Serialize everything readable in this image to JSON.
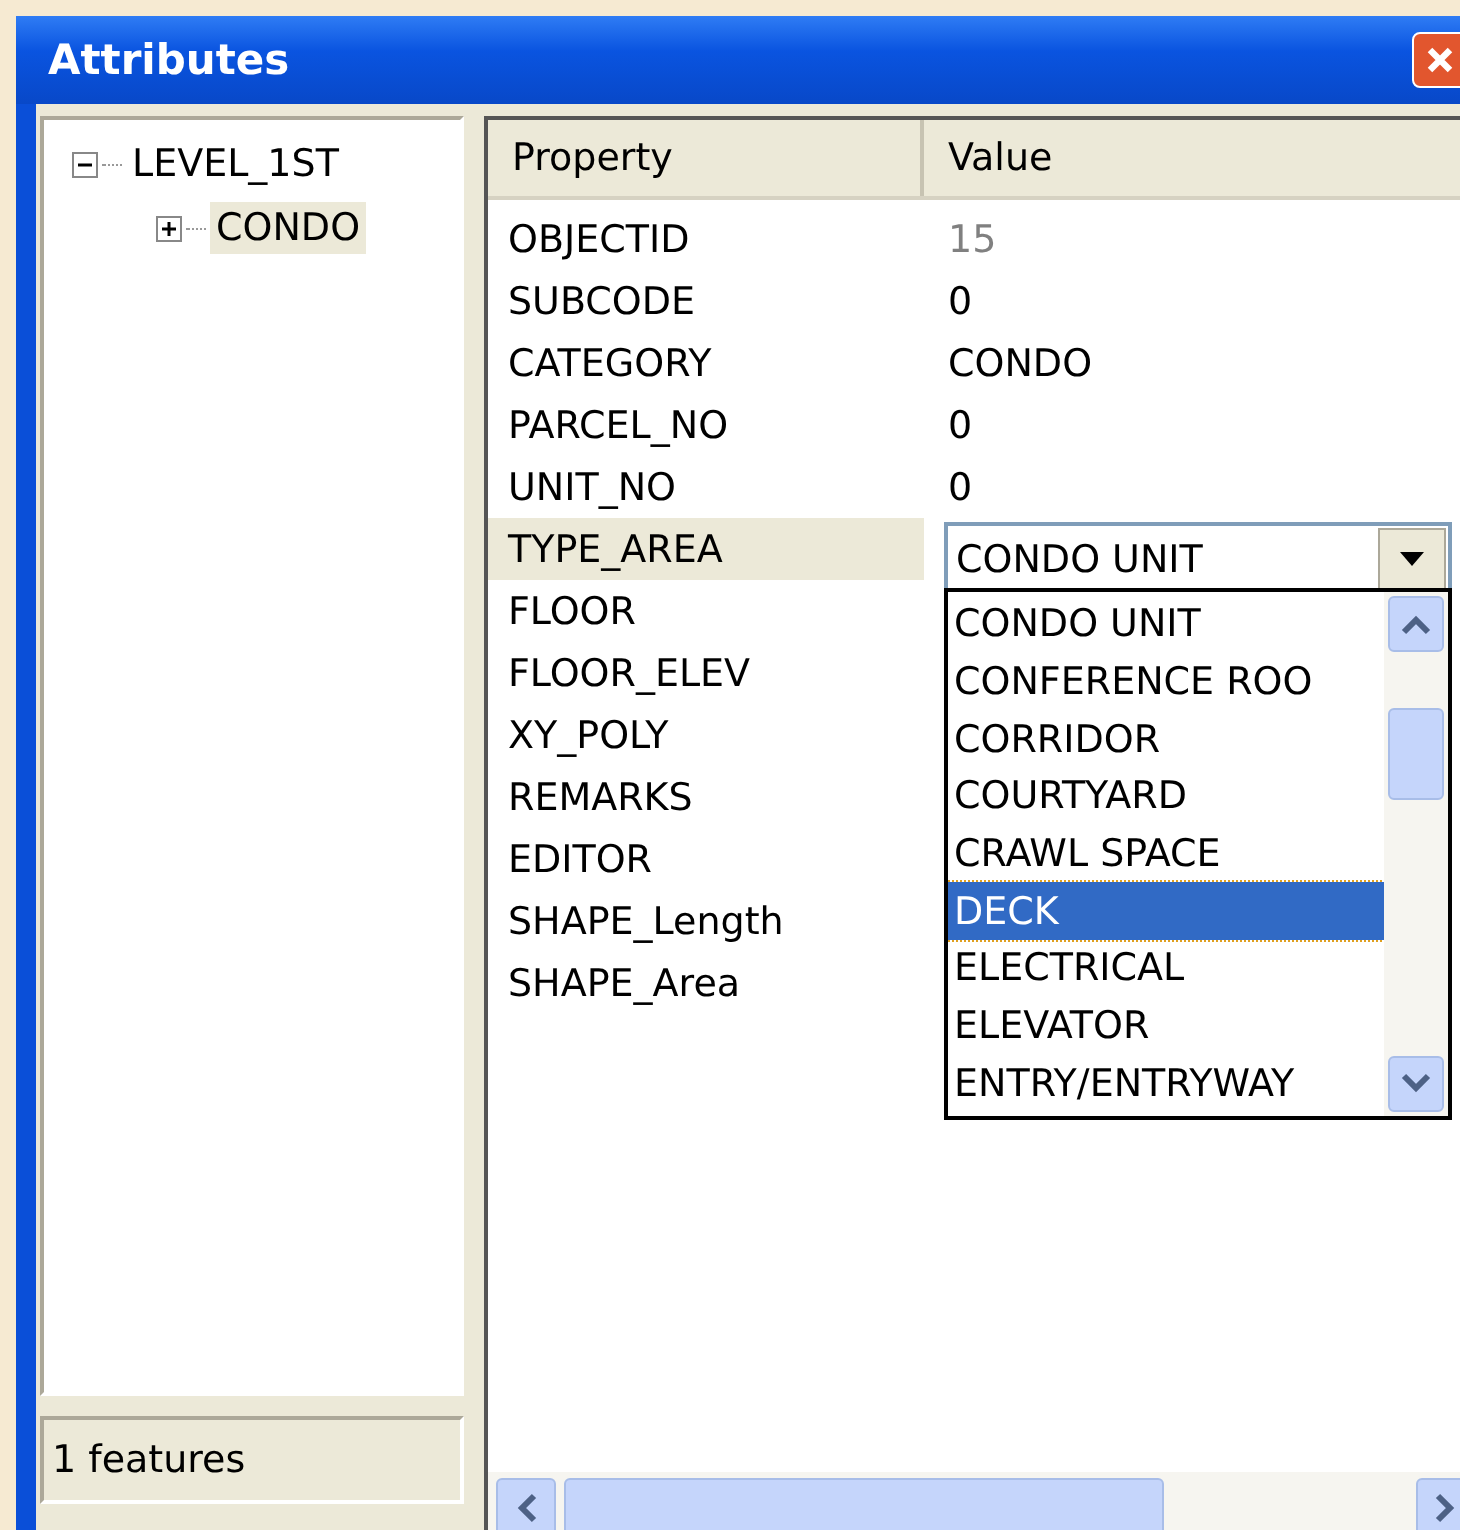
{
  "window": {
    "title": "Attributes"
  },
  "tree": [
    {
      "label": "LEVEL_1ST",
      "expanded": true,
      "selected": false,
      "children": [
        {
          "label": "CONDO",
          "expanded": false,
          "selected": true
        }
      ]
    }
  ],
  "status": "1 features",
  "table": {
    "columns": [
      "Property",
      "Value"
    ],
    "rows": [
      {
        "property": "OBJECTID",
        "value": "15",
        "readonly": true,
        "selected": false
      },
      {
        "property": "SUBCODE",
        "value": "0",
        "readonly": false,
        "selected": false
      },
      {
        "property": "CATEGORY",
        "value": "CONDO",
        "readonly": false,
        "selected": false
      },
      {
        "property": "PARCEL_NO",
        "value": "0",
        "readonly": false,
        "selected": false
      },
      {
        "property": "UNIT_NO",
        "value": "0",
        "readonly": false,
        "selected": false
      },
      {
        "property": "TYPE_AREA",
        "value": "CONDO UNIT",
        "readonly": false,
        "selected": true
      },
      {
        "property": "FLOOR",
        "selected": false
      },
      {
        "property": "FLOOR_ELEV",
        "selected": false
      },
      {
        "property": "XY_POLY",
        "selected": false
      },
      {
        "property": "REMARKS",
        "selected": false
      },
      {
        "property": "EDITOR",
        "selected": false
      },
      {
        "property": "SHAPE_Length",
        "selected": false
      },
      {
        "property": "SHAPE_Area",
        "selected": false
      }
    ]
  },
  "dropdown": {
    "options": [
      {
        "label": "CONDO UNIT",
        "selected": false
      },
      {
        "label": "CONFERENCE ROO",
        "selected": false
      },
      {
        "label": "CORRIDOR",
        "selected": false
      },
      {
        "label": "COURTYARD",
        "selected": false
      },
      {
        "label": "CRAWL SPACE",
        "selected": false
      },
      {
        "label": "DECK",
        "selected": true
      },
      {
        "label": "ELECTRICAL",
        "selected": false
      },
      {
        "label": "ELEVATOR",
        "selected": false
      },
      {
        "label": "ENTRY/ENTRYWAY",
        "selected": false
      }
    ]
  }
}
